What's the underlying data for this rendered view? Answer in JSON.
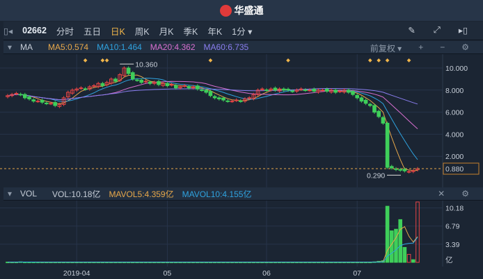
{
  "brand": {
    "name": "华盛通"
  },
  "toolbar": {
    "code": "02662",
    "tabs": [
      "分时",
      "五日",
      "日K",
      "周K",
      "月K",
      "季K",
      "年K"
    ],
    "active": "日K",
    "interval": "1分 ▾"
  },
  "ma": {
    "label": "MA",
    "ma5": "MA5:0.574",
    "ma10": "MA10:1.464",
    "ma20": "MA20:4.362",
    "ma60": "MA60:6.735",
    "adjust": "前复权 ▾",
    "colors": {
      "ma5": "#e8a84a",
      "ma10": "#2fa3e0",
      "ma20": "#d86fd0",
      "ma60": "#8a7ef0"
    }
  },
  "vol": {
    "label": "VOL",
    "vol": "VOL:10.18亿",
    "mavol5": "MAVOL5:4.359亿",
    "mavol10": "MAVOL10:4.155亿"
  },
  "chart_data": {
    "type": "candlestick",
    "price_ticks": [
      "10.000",
      "8.000",
      "6.000",
      "4.000",
      "2.000"
    ],
    "price_tick_values": [
      10,
      8,
      6,
      4,
      2
    ],
    "last_price": "0.880",
    "high_label": "10.360",
    "low_label": "0.290",
    "closes": [
      7.5,
      7.6,
      7.7,
      7.6,
      7.3,
      7.2,
      7.0,
      7.0,
      6.9,
      6.8,
      6.8,
      6.6,
      6.7,
      7.3,
      7.8,
      8.0,
      8.1,
      8.2,
      8.1,
      8.3,
      8.4,
      8.6,
      8.4,
      8.7,
      9.0,
      8.8,
      9.4,
      10.0,
      9.5,
      9.0,
      8.9,
      8.7,
      8.8,
      8.6,
      8.7,
      8.5,
      8.6,
      8.4,
      8.5,
      8.2,
      8.3,
      8.4,
      8.2,
      8.3,
      8.1,
      8.0,
      7.8,
      7.5,
      7.3,
      7.2,
      7.1,
      7.0,
      7.0,
      7.1,
      7.0,
      7.2,
      7.3,
      7.6,
      8.0,
      8.1,
      8.0,
      8.1,
      8.0,
      8.1,
      8.0,
      8.0,
      7.9,
      8.0,
      8.1,
      8.0,
      8.0,
      7.9,
      8.0,
      8.0,
      7.9,
      8.0,
      7.8,
      7.9,
      8.0,
      7.8,
      7.6,
      7.3,
      7.0,
      6.8,
      6.6,
      6.0,
      5.6,
      5.0,
      1.0,
      0.95,
      0.8,
      0.75,
      0.68,
      0.62,
      0.7,
      0.88
    ],
    "volumes": [
      0.05,
      0.05,
      0.05,
      0.1,
      0.05,
      0.05,
      0.05,
      0.05,
      0.05,
      0.05,
      0.05,
      0.05,
      0.05,
      0.05,
      0.05,
      0.05,
      0.05,
      0.05,
      0.05,
      0.05,
      0.05,
      0.05,
      0.05,
      0.05,
      0.05,
      0.05,
      0.05,
      0.05,
      0.05,
      0.05,
      0.05,
      0.05,
      0.05,
      0.05,
      0.05,
      0.05,
      0.05,
      0.05,
      0.05,
      0.05,
      0.05,
      0.05,
      0.05,
      0.05,
      0.05,
      0.05,
      0.05,
      0.05,
      0.05,
      0.05,
      0.05,
      0.05,
      0.05,
      0.05,
      0.05,
      0.05,
      0.05,
      0.05,
      0.05,
      0.05,
      0.05,
      0.05,
      0.05,
      0.05,
      0.05,
      0.05,
      0.05,
      0.05,
      0.05,
      0.05,
      0.05,
      0.05,
      0.05,
      0.05,
      0.05,
      0.05,
      0.05,
      0.05,
      0.05,
      0.05,
      0.05,
      0.05,
      0.05,
      0.05,
      0.05,
      0.1,
      0.2,
      0.3,
      10.5,
      5.9,
      6.2,
      8.0,
      2.8,
      1.5,
      0.5,
      11.3
    ],
    "vol_ticks": [
      "10.18",
      "6.79",
      "3.39",
      "亿"
    ],
    "vol_tick_values": [
      10.18,
      6.79,
      3.39,
      0
    ],
    "dates": [
      "2019-04",
      "05",
      "06",
      "07"
    ],
    "date_indices": [
      16,
      37,
      60,
      81
    ]
  }
}
